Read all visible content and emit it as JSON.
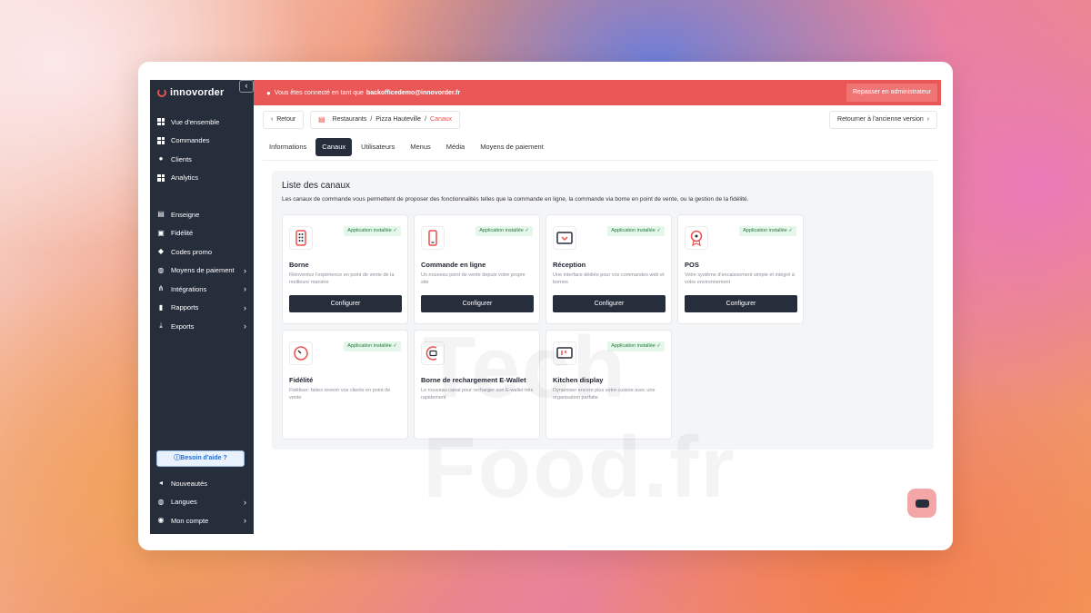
{
  "sidebar": {
    "logo": "innovorder",
    "collapse_icon": "chevron-left-icon",
    "nav_top": [
      {
        "label": "Vue d'ensemble",
        "icon": "grid-icon"
      },
      {
        "label": "Commandes",
        "icon": "grid-icon"
      },
      {
        "label": "Clients",
        "icon": "user-icon"
      },
      {
        "label": "Analytics",
        "icon": "grid-icon"
      }
    ],
    "nav_middle": [
      {
        "label": "Enseigne",
        "icon": "store-icon"
      },
      {
        "label": "Fidélité",
        "icon": "gift-icon"
      },
      {
        "label": "Codes promo",
        "icon": "tag-icon"
      },
      {
        "label": "Moyens de paiement",
        "icon": "globe-icon",
        "expandable": true
      },
      {
        "label": "Intégrations",
        "icon": "integrations-icon",
        "expandable": true
      },
      {
        "label": "Rapports",
        "icon": "chart-icon",
        "expandable": true
      },
      {
        "label": "Exports",
        "icon": "download-icon",
        "expandable": true
      }
    ],
    "help_button": "ⓘBesoin d'aide ?",
    "nav_bottom": [
      {
        "label": "Nouveautés",
        "icon": "megaphone-icon"
      },
      {
        "label": "Langues",
        "icon": "globe-icon",
        "expandable": true
      },
      {
        "label": "Mon compte",
        "icon": "account-icon",
        "expandable": true
      }
    ]
  },
  "banner": {
    "text": "Vous êtes connecté en tant que",
    "email": "backofficedemo@innovorder.fr",
    "button": "Repasser en administrateur",
    "color": "#ea5757"
  },
  "toolbar": {
    "back": "Retour",
    "breadcrumb": [
      "Restaurants",
      "Pizza Hauteville",
      "Canaux"
    ],
    "old_version": "Retourner à l'ancienne version"
  },
  "tabs": [
    {
      "label": "Informations",
      "active": false
    },
    {
      "label": "Canaux",
      "active": true
    },
    {
      "label": "Utilisateurs",
      "active": false
    },
    {
      "label": "Menus",
      "active": false
    },
    {
      "label": "Média",
      "active": false
    },
    {
      "label": "Moyens de paiement",
      "active": false
    }
  ],
  "channels": {
    "title": "Liste des canaux",
    "description": "Les canaux de commande vous permettent de proposer des fonctionnalités telles que la commande en ligne, la commande via borne en point de vente, ou la gestion de la fidélité.",
    "badge_label": "Application installée ✓",
    "configure_label": "Configurer",
    "cards": [
      {
        "title": "Borne",
        "desc": "Réinventez l'expérience en point de vente de la meilleure manière",
        "installed": true,
        "configurable": true,
        "icon": "kiosk-icon"
      },
      {
        "title": "Commande en ligne",
        "desc": "Un nouveau point de vente depuis votre propre site",
        "installed": true,
        "configurable": true,
        "icon": "smartphone-icon"
      },
      {
        "title": "Réception",
        "desc": "Une interface dédiée pour vos commandes web et bornes",
        "installed": true,
        "configurable": true,
        "icon": "tablet-icon"
      },
      {
        "title": "POS",
        "desc": "Votre système d'encaissement simple et intégré à votre environnement",
        "installed": true,
        "configurable": true,
        "icon": "pos-icon"
      },
      {
        "title": "Fidélité",
        "desc": "Fidéliser: faites revenir vos clients en point de vente",
        "installed": true,
        "configurable": false,
        "icon": "loyalty-icon"
      },
      {
        "title": "Borne de rechargement E-Wallet",
        "desc": "Le nouveau canal pour recharger son E-wallet très rapidement",
        "installed": false,
        "configurable": false,
        "icon": "wallet-icon"
      },
      {
        "title": "Kitchen display",
        "desc": "Dynamiser encore plus votre cuisine avec une organisation parfaite",
        "installed": true,
        "configurable": false,
        "icon": "kitchen-display-icon"
      }
    ]
  },
  "watermark": "Tech Food.fr",
  "chat_icon": "chat-icon"
}
